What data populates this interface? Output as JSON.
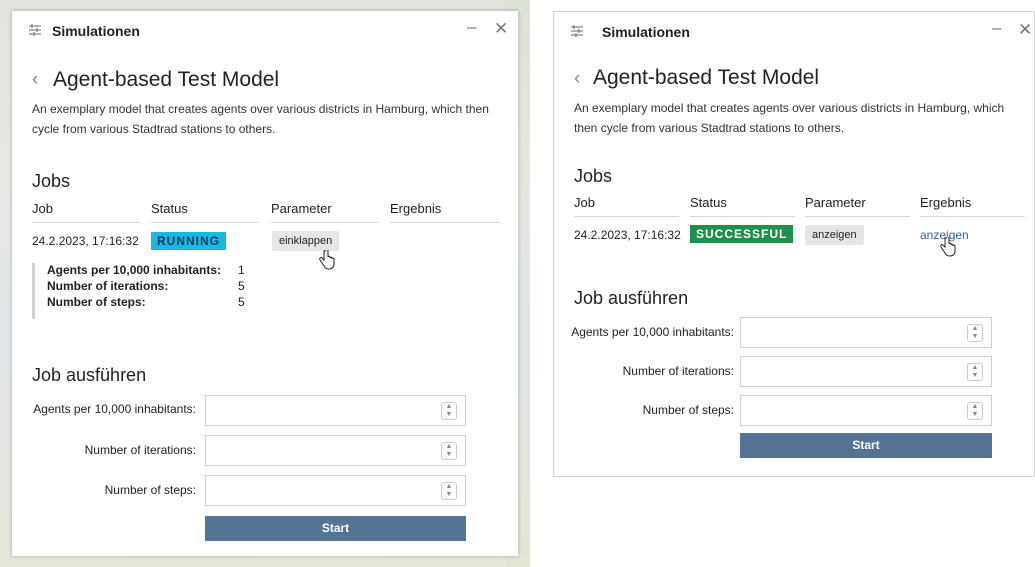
{
  "left": {
    "title": "Simulationen",
    "model_title": "Agent-based Test Model",
    "description": "An exemplary model that creates agents over various districts in Hamburg, which then cycle from various Stadtrad stations to others.",
    "jobs_heading": "Jobs",
    "columns": [
      "Job",
      "Status",
      "Parameter",
      "Ergebnis"
    ],
    "job": {
      "time": "24.2.2023, 17:16:32",
      "status": "RUNNING",
      "param_button": "einklappen"
    },
    "params": [
      {
        "label": "Agents per 10,000 inhabitants:",
        "value": "1"
      },
      {
        "label": "Number of iterations:",
        "value": "5"
      },
      {
        "label": "Number of steps:",
        "value": "5"
      }
    ],
    "run_heading": "Job ausführen",
    "form": {
      "agents_label": "Agents per 10,000 inhabitants:",
      "iterations_label": "Number of iterations:",
      "steps_label": "Number of steps:",
      "start_label": "Start"
    }
  },
  "right": {
    "title": "Simulationen",
    "model_title": "Agent-based Test Model",
    "description": "An exemplary model that creates agents over various districts in Hamburg, which then cycle from various Stadtrad stations to others.",
    "jobs_heading": "Jobs",
    "columns": [
      "Job",
      "Status",
      "Parameter",
      "Ergebnis"
    ],
    "job": {
      "time": "24.2.2023, 17:16:32",
      "status": "SUCCESSFUL",
      "param_button": "anzeigen",
      "result_link": "anzeigen"
    },
    "run_heading": "Job ausführen",
    "form": {
      "agents_label": "Agents per 10,000 inhabitants:",
      "iterations_label": "Number of iterations:",
      "steps_label": "Number of steps:",
      "start_label": "Start"
    }
  },
  "icons": {
    "app": "sliders-icon",
    "minimize": "minimize-icon",
    "close": "close-icon",
    "back": "chevron-left-icon",
    "stepper": "stepper-icon",
    "cursor": "hand-pointer-icon"
  },
  "colors": {
    "running": "#19b7e4",
    "successful": "#1f8f4e",
    "start_button": "#557395",
    "link": "#2f5fa8"
  }
}
